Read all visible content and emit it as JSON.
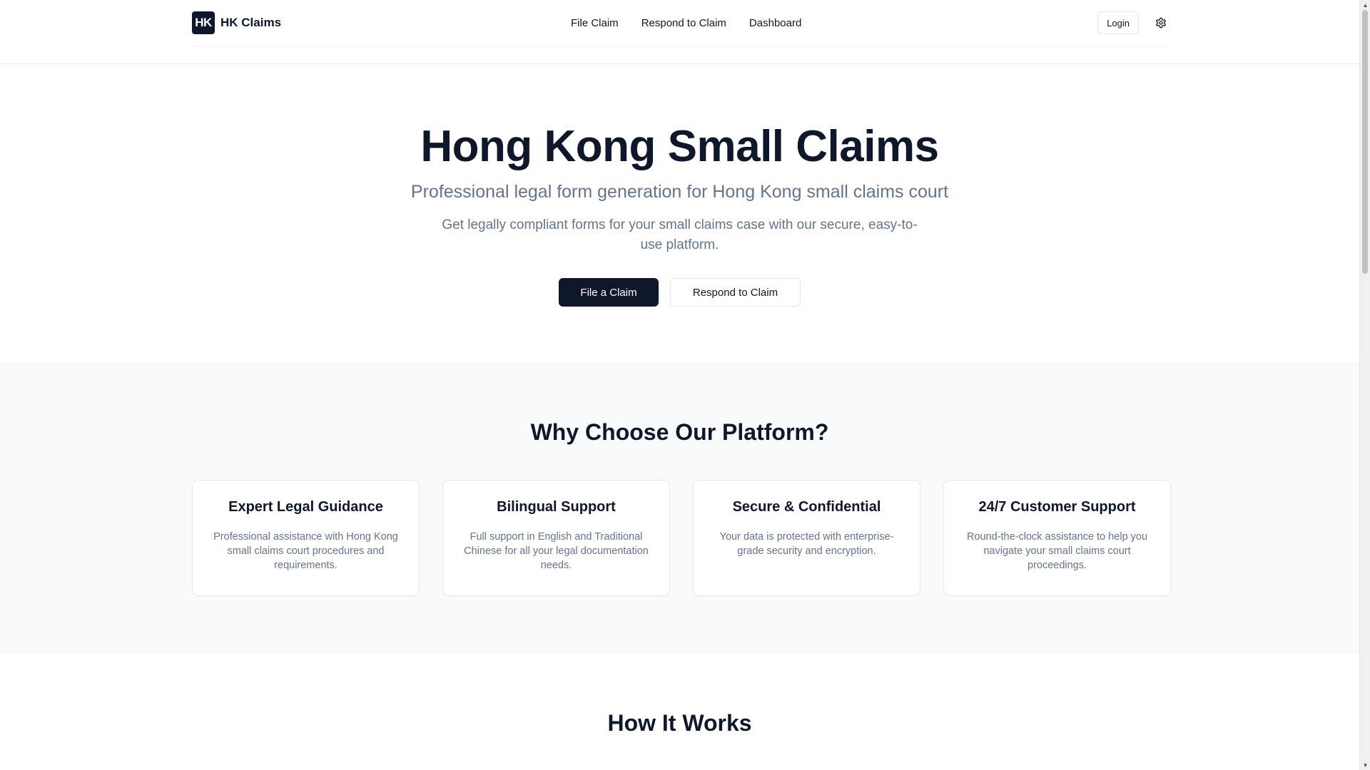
{
  "header": {
    "logo_text": "HK",
    "brand_name": "HK Claims",
    "nav": [
      {
        "label": "File Claim"
      },
      {
        "label": "Respond to Claim"
      },
      {
        "label": "Dashboard"
      }
    ],
    "login_label": "Login",
    "settings_icon": "gear-icon"
  },
  "hero": {
    "title": "Hong Kong Small Claims",
    "subtitle": "Professional legal form generation for Hong Kong small claims court",
    "description": "Get legally compliant forms for your small claims case with our secure, easy-to-use platform.",
    "primary_button": "File a Claim",
    "secondary_button": "Respond to Claim"
  },
  "features": {
    "title": "Why Choose Our Platform?",
    "cards": [
      {
        "title": "Expert Legal Guidance",
        "description": "Professional assistance with Hong Kong small claims court procedures and requirements."
      },
      {
        "title": "Bilingual Support",
        "description": "Full support in English and Traditional Chinese for all your legal documentation needs."
      },
      {
        "title": "Secure & Confidential",
        "description": "Your data is protected with enterprise-grade security and encryption."
      },
      {
        "title": "24/7 Customer Support",
        "description": "Round-the-clock assistance to help you navigate your small claims court proceedings."
      }
    ]
  },
  "how_it_works": {
    "title": "How It Works"
  },
  "colors": {
    "primary": "#0f172a",
    "muted_text": "#64748b",
    "border": "#e5e7eb",
    "section_bg": "#f8fafc"
  }
}
